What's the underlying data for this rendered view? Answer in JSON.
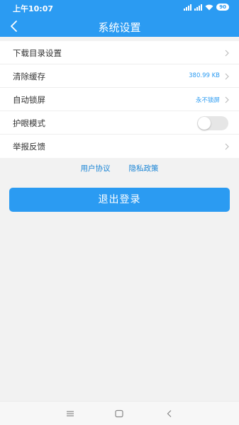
{
  "status_bar": {
    "time": "上午10:07",
    "signal1_label": "HD",
    "signal2_label": "HD",
    "battery": "90"
  },
  "header": {
    "title": "系统设置",
    "back_icon": "chevron-left-icon"
  },
  "settings": {
    "items": [
      {
        "label": "下载目录设置",
        "value": "",
        "control": "chevron"
      },
      {
        "label": "清除缓存",
        "value": "380.99 KB",
        "control": "chevron"
      },
      {
        "label": "自动锁屏",
        "value": "永不锁屏",
        "control": "chevron"
      },
      {
        "label": "护眼模式",
        "value": "",
        "control": "toggle",
        "toggle_on": false
      },
      {
        "label": "举报反馈",
        "value": "",
        "control": "chevron"
      }
    ]
  },
  "links": {
    "user_agreement": "用户协议",
    "privacy_policy": "隐私政策"
  },
  "logout": {
    "label": "退出登录"
  },
  "colors": {
    "accent": "#2b9bf2",
    "page_background": "#f2f2f2",
    "value_text": "#2b9bf2"
  },
  "system_nav": {
    "menu_icon": "menu-icon",
    "home_icon": "home-icon",
    "back_icon": "back-triangle-icon"
  }
}
